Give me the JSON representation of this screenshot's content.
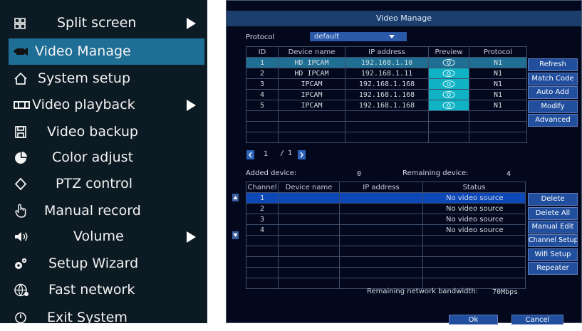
{
  "menu": {
    "items": [
      {
        "label": "Split screen",
        "icon": "grid-icon",
        "has_submenu": true
      },
      {
        "label": "Video Manage",
        "icon": "camera-icon",
        "selected": true
      },
      {
        "label": "System setup",
        "icon": "home-icon"
      },
      {
        "label": "Video playback",
        "icon": "film-icon",
        "has_submenu": true
      },
      {
        "label": "Video backup",
        "icon": "floppy-disk-icon"
      },
      {
        "label": "Color adjust",
        "icon": "color-palette-icon"
      },
      {
        "label": "PTZ control",
        "icon": "ptz-diamond-icon"
      },
      {
        "label": "Manual record",
        "icon": "hand-pointer-icon"
      },
      {
        "label": "Volume",
        "icon": "speaker-icon",
        "has_submenu": true
      },
      {
        "label": "Setup Wizard",
        "icon": "gears-icon"
      },
      {
        "label": "Fast network",
        "icon": "globe-network-icon"
      },
      {
        "label": "Exit System",
        "icon": "power-icon"
      }
    ]
  },
  "dialog": {
    "title": "Video Manage",
    "protocol_label": "Protocol",
    "protocol_value": "default",
    "search_table": {
      "headers": [
        "ID",
        "Device name",
        "IP address",
        "Preview",
        "Protocol"
      ],
      "rows": [
        {
          "id": "1",
          "name": "HD IPCAM",
          "ip": "192.168.1.10",
          "protocol": "N1"
        },
        {
          "id": "2",
          "name": "HD IPCAM",
          "ip": "192.168.1.11",
          "protocol": "N1"
        },
        {
          "id": "3",
          "name": "IPCAM",
          "ip": "192.168.1.168",
          "protocol": "N1"
        },
        {
          "id": "4",
          "name": "IPCAM",
          "ip": "192.168.1.168",
          "protocol": "N1"
        },
        {
          "id": "5",
          "name": "IPCAM",
          "ip": "192.168.1.168",
          "protocol": "N1"
        }
      ],
      "selected_row": 0
    },
    "search_buttons": [
      "Refresh",
      "Match Code",
      "Auto Add",
      "Modify",
      "Advanced"
    ],
    "pagination": {
      "current": "1",
      "separator": "/",
      "total": "1"
    },
    "added_label": "Added device:",
    "added_count": "0",
    "remaining_label": "Remaining device:",
    "remaining_count": "4",
    "channel_table": {
      "headers": [
        "Channel",
        "Device name",
        "IP address",
        "Status"
      ],
      "rows": [
        {
          "channel": "1",
          "name": "",
          "ip": "",
          "status": "No video source"
        },
        {
          "channel": "2",
          "name": "",
          "ip": "",
          "status": "No video source"
        },
        {
          "channel": "3",
          "name": "",
          "ip": "",
          "status": "No video source"
        },
        {
          "channel": "4",
          "name": "",
          "ip": "",
          "status": "No video source"
        }
      ],
      "selected_row": 0
    },
    "channel_buttons": [
      "Delete",
      "Delete All",
      "Manual Edit",
      "Channel Setup",
      "Wifi Setup",
      "Repeater"
    ],
    "bandwidth_label": "Remaining network bandwidth:",
    "bandwidth_value": "70Mbps",
    "ok_label": "Ok",
    "cancel_label": "Cancel"
  },
  "colors": {
    "menu_bg": "#0c1a24",
    "menu_selected": "#1f6e96",
    "dialog_bg": "#03081d",
    "title_bar": "#1b3e6d",
    "button": "#214f9e",
    "selected_row": "#1f6f93",
    "highlight_row": "#0e47b8",
    "preview_cell": "#10b3c4"
  }
}
